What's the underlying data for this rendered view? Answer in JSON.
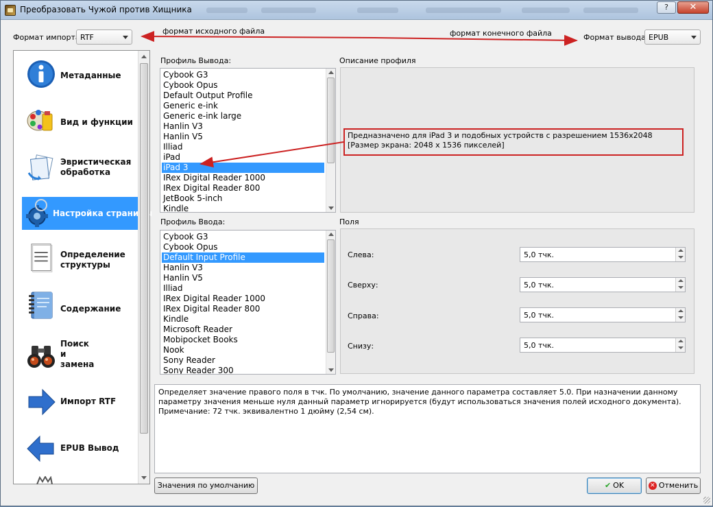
{
  "window": {
    "title": "Преобразовать Чужой против Хищника",
    "help_label": "?",
    "close_label": "✕"
  },
  "format": {
    "import_label": "Формат импорта:",
    "import_value": "RTF",
    "output_label": "Формат вывода:",
    "output_value": "EPUB"
  },
  "annotations": {
    "source_format": "формат исходного файла",
    "target_format": "формат конечного файла"
  },
  "sidebar": {
    "items": [
      {
        "label": "Метаданные",
        "icon": "info-icon"
      },
      {
        "label": "Вид и функции",
        "icon": "paint-palette-icon"
      },
      {
        "label": "Эвристическая\nобработка",
        "icon": "heuristic-pages-icon"
      },
      {
        "label": "Настройка страницы",
        "icon": "page-setup-gear-icon",
        "selected": true
      },
      {
        "label": "Определение\nструктуры",
        "icon": "document-structure-icon"
      },
      {
        "label": "Содержание",
        "icon": "notebook-toc-icon"
      },
      {
        "label": "Поиск\nи\nзамена",
        "icon": "binoculars-icon"
      },
      {
        "label": "Импорт RTF",
        "icon": "arrow-right-icon"
      },
      {
        "label": "EPUB Вывод",
        "icon": "arrow-left-icon"
      }
    ]
  },
  "output_profile": {
    "label": "Профиль Вывода:",
    "items": [
      "Cybook G3",
      "Cybook Opus",
      "Default Output Profile",
      "Generic e-ink",
      "Generic e-ink large",
      "Hanlin V3",
      "Hanlin V5",
      "Illiad",
      "iPad",
      "iPad 3",
      "IRex Digital Reader 1000",
      "IRex Digital Reader 800",
      "JetBook 5-inch",
      "Kindle"
    ],
    "selected": "iPad 3"
  },
  "profile_description": {
    "label": "Описание профиля",
    "text": "Предназначено для iPad 3 и подобных устройств с разрешением 1536x2048 [Размер экрана: 2048 x 1536 пикселей]"
  },
  "input_profile": {
    "label": "Профиль Ввода:",
    "items": [
      "Cybook G3",
      "Cybook Opus",
      "Default Input Profile",
      "Hanlin V3",
      "Hanlin V5",
      "Illiad",
      "IRex Digital Reader 1000",
      "IRex Digital Reader 800",
      "Kindle",
      "Microsoft Reader",
      "Mobipocket Books",
      "Nook",
      "Sony Reader",
      "Sony Reader 300"
    ],
    "selected": "Default Input Profile"
  },
  "margins": {
    "label": "Поля",
    "left_label": "Слева:",
    "left_value": "5,0 тчк.",
    "top_label": "Сверху:",
    "top_value": "5,0 тчк.",
    "right_label": "Справа:",
    "right_value": "5,0 тчк.",
    "bottom_label": "Снизу:",
    "bottom_value": "5,0 тчк."
  },
  "help_text": "Определяет значение правого поля в тчк. По умолчанию, значение данного параметра составляет 5.0. При назначении данному параметру значения меньше нуля данный параметр игнорируется (будут использоваться значения полей исходного документа). Примечание: 72 тчк. эквивалентно 1 дюйму (2,54 см).",
  "buttons": {
    "defaults": "Значения по умолчанию",
    "ok": "OK",
    "cancel": "Отменить"
  },
  "colors": {
    "selection": "#3399ff",
    "annotation_red": "#cc2222"
  }
}
